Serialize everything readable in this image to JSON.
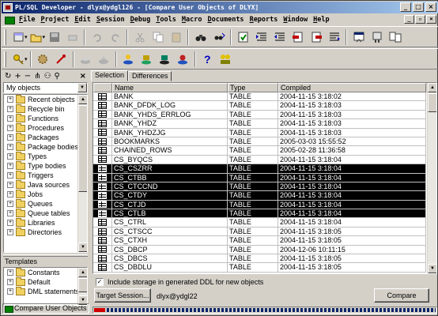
{
  "window": {
    "title": "PL/SQL Developer - dlyx@ydgl126 - [Compare User Objects of DLYX]",
    "controls": [
      "_",
      "□",
      "×"
    ],
    "mdi_controls": [
      "_",
      "▫",
      "×"
    ]
  },
  "menu": [
    "File",
    "Project",
    "Edit",
    "Session",
    "Debug",
    "Tools",
    "Macro",
    "Documents",
    "Reports",
    "Window",
    "Help"
  ],
  "left_panel": {
    "selector_value": "My objects",
    "tree_items": [
      "Recent objects",
      "Recycle bin",
      "Functions",
      "Procedures",
      "Packages",
      "Package bodies",
      "Types",
      "Type bodies",
      "Triggers",
      "Java sources",
      "Jobs",
      "Queues",
      "Queue tables",
      "Libraries",
      "Directories"
    ],
    "templates_label": "Templates",
    "template_items": [
      "Constants",
      "Default",
      "DML statements"
    ]
  },
  "tabs": [
    "Selection",
    "Differences"
  ],
  "grid": {
    "columns": [
      "",
      "Name",
      "Type",
      "Compiled"
    ],
    "rows": [
      {
        "name": "BANK",
        "type": "TABLE",
        "compiled": "2004-11-15 3:18:02",
        "selected": false
      },
      {
        "name": "BANK_DFDK_LOG",
        "type": "TABLE",
        "compiled": "2004-11-15 3:18:03",
        "selected": false
      },
      {
        "name": "BANK_YHDS_ERRLOG",
        "type": "TABLE",
        "compiled": "2004-11-15 3:18:03",
        "selected": false
      },
      {
        "name": "BANK_YHDZ",
        "type": "TABLE",
        "compiled": "2004-11-15 3:18:03",
        "selected": false
      },
      {
        "name": "BANK_YHDZJG",
        "type": "TABLE",
        "compiled": "2004-11-15 3:18:03",
        "selected": false
      },
      {
        "name": "BOOKMARKS",
        "type": "TABLE",
        "compiled": "2005-03-03 15:55:52",
        "selected": false
      },
      {
        "name": "CHAINED_ROWS",
        "type": "TABLE",
        "compiled": "2005-02-28 11:36:58",
        "selected": false
      },
      {
        "name": "CS_BYQCS",
        "type": "TABLE",
        "compiled": "2004-11-15 3:18:04",
        "selected": false
      },
      {
        "name": "CS_CSZRR",
        "type": "TABLE",
        "compiled": "2004-11-15 3:18:04",
        "selected": true
      },
      {
        "name": "CS_CTBB",
        "type": "TABLE",
        "compiled": "2004-11-15 3:18:04",
        "selected": true
      },
      {
        "name": "CS_CTCCND",
        "type": "TABLE",
        "compiled": "2004-11-15 3:18:04",
        "selected": true
      },
      {
        "name": "CS_CTDY",
        "type": "TABLE",
        "compiled": "2004-11-15 3:18:04",
        "selected": true
      },
      {
        "name": "CS_CTJD",
        "type": "TABLE",
        "compiled": "2004-11-15 3:18:04",
        "selected": true
      },
      {
        "name": "CS_CTLB",
        "type": "TABLE",
        "compiled": "2004-11-15 3:18:04",
        "selected": true
      },
      {
        "name": "CS_CTRL",
        "type": "TABLE",
        "compiled": "2004-11-15 3:18:04",
        "selected": false
      },
      {
        "name": "CS_CTSCC",
        "type": "TABLE",
        "compiled": "2004-11-15 3:18:05",
        "selected": false
      },
      {
        "name": "CS_CTXH",
        "type": "TABLE",
        "compiled": "2004-11-15 3:18:05",
        "selected": false
      },
      {
        "name": "CS_DBCP",
        "type": "TABLE",
        "compiled": "2004-12-06 10:11:15",
        "selected": false
      },
      {
        "name": "CS_DBCS",
        "type": "TABLE",
        "compiled": "2004-11-15 3:18:05",
        "selected": false
      },
      {
        "name": "CS_DBDLU",
        "type": "TABLE",
        "compiled": "2004-11-15 3:18:05",
        "selected": false
      }
    ]
  },
  "options": {
    "include_storage_label": "Include storage in generated DDL for new objects",
    "include_storage_checked": true
  },
  "buttons": {
    "target_session": "Target Session...",
    "compare": "Compare"
  },
  "target_user": "dlyx@ydgl22",
  "status": {
    "task_label": "Compare User Objects of D"
  }
}
